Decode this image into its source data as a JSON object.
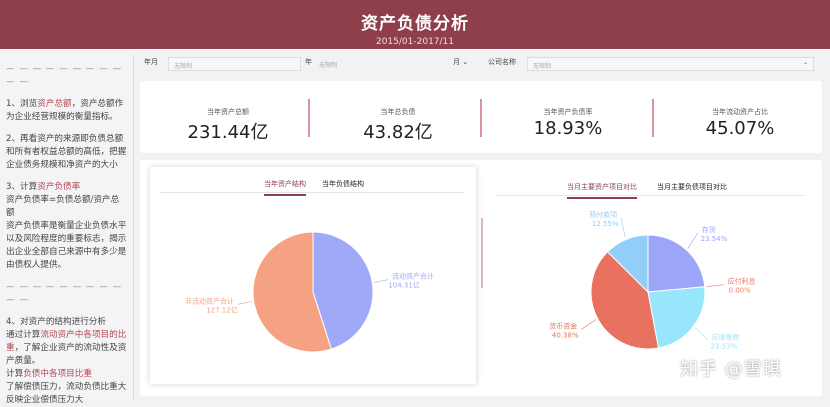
{
  "header": {
    "title": "资产负债分析",
    "subtitle": "2015/01-2017/11"
  },
  "notes": {
    "dash": "— — — — — — — — — — —",
    "p1": [
      "1、浏览",
      "资产总额",
      "，资产总额作为企业经营规模的衡量指标。"
    ],
    "p2": "2、再看资产的来源即负债总额和所有者权益总额的高低，把握企业债务规模和净资产的大小",
    "p3": [
      "3、计算",
      "资产负债率"
    ],
    "p3b": "资产负债率=负债总额/资产总额",
    "p3c": "资产负债率是衡量企业负债水平以及风险程度的重要标志，揭示出企业全部自己来源中有多少是由债权人提供。",
    "p4": "4、对资产的结构进行分析",
    "p4b": [
      "通过计算",
      "流动资产中各项目的比重",
      "，了解企业资产的流动性及资产质量。"
    ],
    "p4c": [
      "计算",
      "负债中各项目比重"
    ],
    "p4d": "了解偿债压力，流动负债比重大反映企业偿债压力大"
  },
  "filters": {
    "year_month_label": "年月",
    "from_placeholder": "无限制",
    "year_label": "年",
    "to_placeholder": "无限制",
    "month_label": "月",
    "company_label": "公司名称",
    "company_placeholder": "无限制"
  },
  "kpis": [
    {
      "label": "当年资产总额",
      "value": "231.44亿"
    },
    {
      "label": "当年总负债",
      "value": "43.82亿"
    },
    {
      "label": "当年资产负债率",
      "value": "18.93%"
    },
    {
      "label": "当年流动资产占比",
      "value": "45.07%"
    }
  ],
  "left_tabs": [
    "当年资产结构",
    "当年负债结构"
  ],
  "right_tabs": [
    "当月主要资产项目对比",
    "当月主要负债项目对比"
  ],
  "watermark": "知乎 @雪琪",
  "chart_data": [
    {
      "type": "pie",
      "title": "当年资产结构",
      "slices": [
        {
          "name": "流动资产合计",
          "value": 104.31,
          "label": "104.31亿",
          "color": "#a0a9f8"
        },
        {
          "name": "非流动资产合计",
          "value": 127.12,
          "label": "127.12亿",
          "color": "#f5a282"
        }
      ]
    },
    {
      "type": "pie",
      "title": "当月主要资产项目对比",
      "slices": [
        {
          "name": "存货",
          "value": 23.54,
          "label": "23.54%",
          "color": "#9ba6f8"
        },
        {
          "name": "应付利息",
          "value": 0.0,
          "label": "0.00%",
          "color": "#e8806d"
        },
        {
          "name": "应收账款",
          "value": 23.53,
          "label": "23.53%",
          "color": "#98e6fb"
        },
        {
          "name": "货币资金",
          "value": 40.38,
          "label": "40.38%",
          "color": "#e8725f"
        },
        {
          "name": "预付款项",
          "value": 12.55,
          "label": "12.55%",
          "color": "#93cef8"
        }
      ]
    }
  ]
}
